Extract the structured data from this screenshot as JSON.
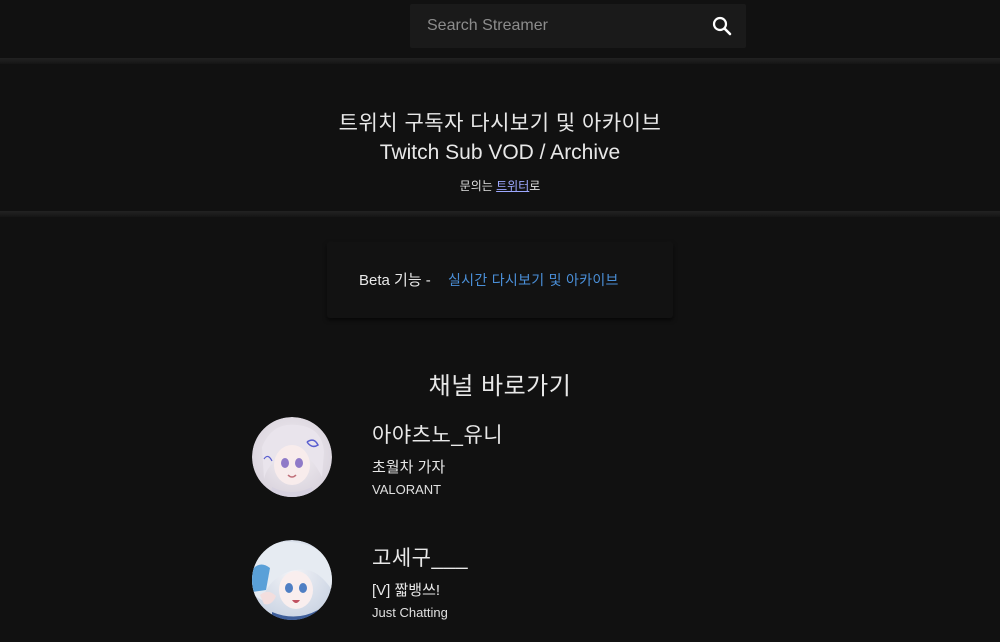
{
  "search": {
    "placeholder": "Search Streamer",
    "icon": "search-icon"
  },
  "hero": {
    "title_ko": "트위치 구독자 다시보기 및 아카이브",
    "title_en": "Twitch Sub VOD / Archive",
    "contact_prefix": "문의는 ",
    "contact_link": "트위터",
    "contact_suffix": "로"
  },
  "beta": {
    "label": "Beta 기능 -",
    "link": "실시간 다시보기 및 아카이브",
    "link_color": "#4a8fd8"
  },
  "channels": {
    "heading": "채널 바로가기",
    "items": [
      {
        "name": "아야츠노_유니",
        "title": "초월차 가자",
        "game": "VALORANT"
      },
      {
        "name": "고세구___",
        "title": "[V] 짧뱅쓰!",
        "game": "Just Chatting"
      }
    ]
  },
  "colors": {
    "background": "#111111",
    "text": "#e8e8e8",
    "accent_link": "#9da8ff"
  }
}
